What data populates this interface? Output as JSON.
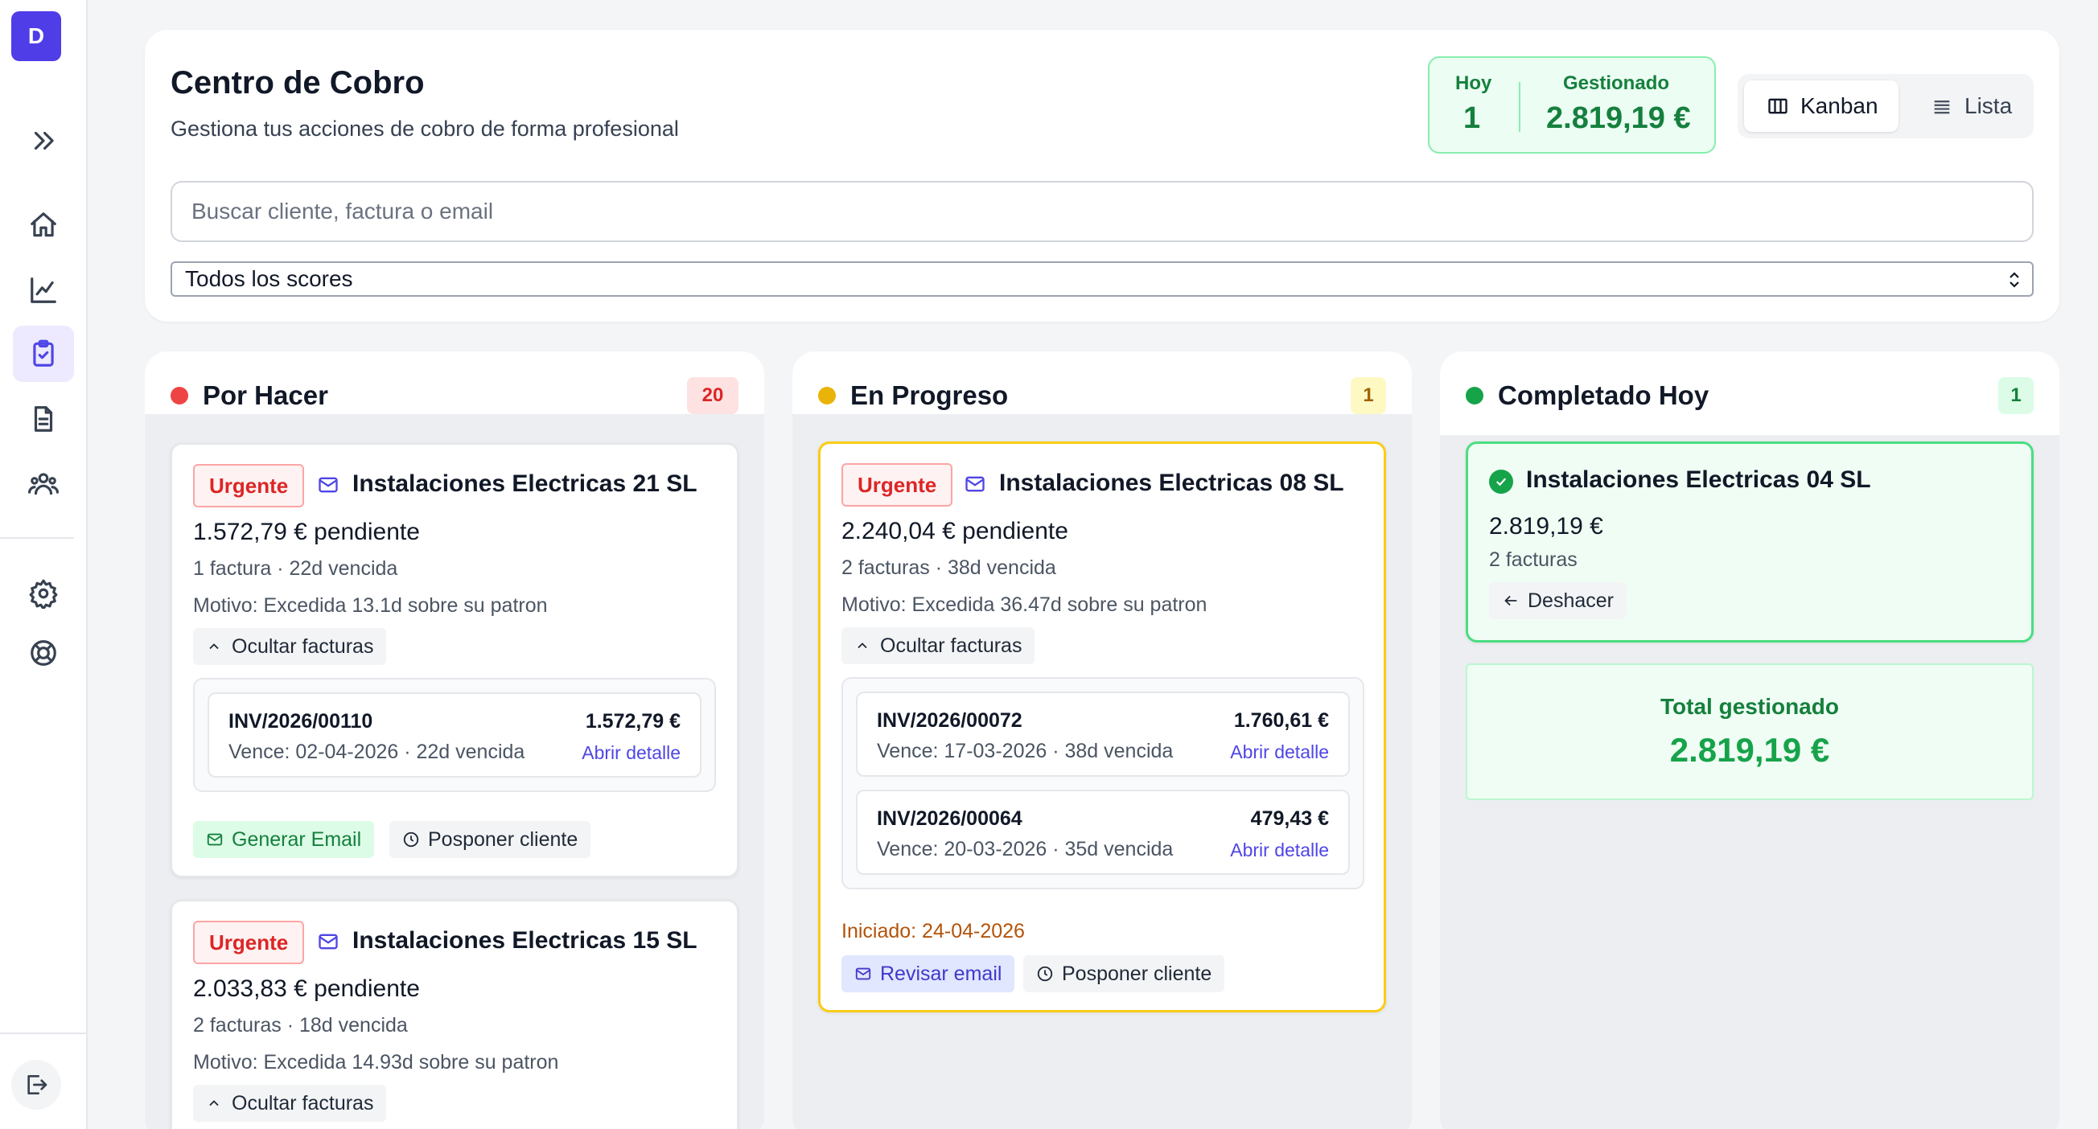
{
  "sidebar": {
    "logo_letter": "D",
    "items": [
      {
        "name": "expand",
        "icon": "chevrons-right-icon"
      },
      {
        "name": "home",
        "icon": "home-icon"
      },
      {
        "name": "analytics",
        "icon": "line-chart-icon"
      },
      {
        "name": "collections",
        "icon": "clipboard-check-icon",
        "active": true
      },
      {
        "name": "documents",
        "icon": "file-icon"
      },
      {
        "name": "clients",
        "icon": "users-icon"
      },
      {
        "name": "settings",
        "icon": "gear-icon"
      },
      {
        "name": "help",
        "icon": "lifebuoy-icon"
      }
    ],
    "logout_icon": "logout-icon"
  },
  "header": {
    "title": "Centro de Cobro",
    "subtitle": "Gestiona tus acciones de cobro de forma profesional",
    "stats": {
      "hoy_label": "Hoy",
      "hoy_value": "1",
      "gestionado_label": "Gestionado",
      "gestionado_value": "2.819,19 €"
    },
    "view_toggle": {
      "kanban": "Kanban",
      "lista": "Lista",
      "active": "kanban"
    },
    "search_placeholder": "Buscar cliente, factura o email",
    "score_filter": "Todos los scores"
  },
  "columns": {
    "todo": {
      "title": "Por Hacer",
      "count": "20",
      "dot_color": "#ef4444",
      "cards": [
        {
          "tag": "Urgente",
          "client": "Instalaciones Electricas 21 SL",
          "amount": "1.572,79 € pendiente",
          "meta": "1 factura · 22d vencida",
          "motivo": "Motivo: Excedida 13.1d sobre su patron",
          "toggle": "Ocultar facturas",
          "invoices": [
            {
              "number": "INV/2026/00110",
              "amount": "1.572,79 €",
              "due": "Vence: 02-04-2026 · 22d vencida",
              "link": "Abrir detalle"
            }
          ],
          "actions": {
            "primary": "Generar Email",
            "secondary": "Posponer cliente"
          }
        },
        {
          "tag": "Urgente",
          "client": "Instalaciones Electricas 15 SL",
          "amount": "2.033,83 € pendiente",
          "meta": "2 facturas · 18d vencida",
          "motivo": "Motivo: Excedida 14.93d sobre su patron",
          "toggle": "Ocultar facturas"
        }
      ]
    },
    "progress": {
      "title": "En Progreso",
      "count": "1",
      "dot_color": "#eab308",
      "cards": [
        {
          "tag": "Urgente",
          "client": "Instalaciones Electricas 08 SL",
          "amount": "2.240,04 € pendiente",
          "meta": "2 facturas · 38d vencida",
          "motivo": "Motivo: Excedida 36.47d sobre su patron",
          "toggle": "Ocultar facturas",
          "invoices": [
            {
              "number": "INV/2026/00072",
              "amount": "1.760,61 €",
              "due": "Vence: 17-03-2026 · 38d vencida",
              "link": "Abrir detalle"
            },
            {
              "number": "INV/2026/00064",
              "amount": "479,43 €",
              "due": "Vence: 20-03-2026 · 35d vencida",
              "link": "Abrir detalle"
            }
          ],
          "started": "Iniciado: 24-04-2026",
          "actions": {
            "primary": "Revisar email",
            "secondary": "Posponer cliente"
          }
        }
      ]
    },
    "done": {
      "title": "Completado Hoy",
      "count": "1",
      "dot_color": "#16a34a",
      "cards": [
        {
          "client": "Instalaciones Electricas 04 SL",
          "amount": "2.819,19 €",
          "meta": "2 facturas",
          "undo": "Deshacer"
        }
      ],
      "total_label": "Total gestionado",
      "total_value": "2.819,19 €"
    }
  }
}
